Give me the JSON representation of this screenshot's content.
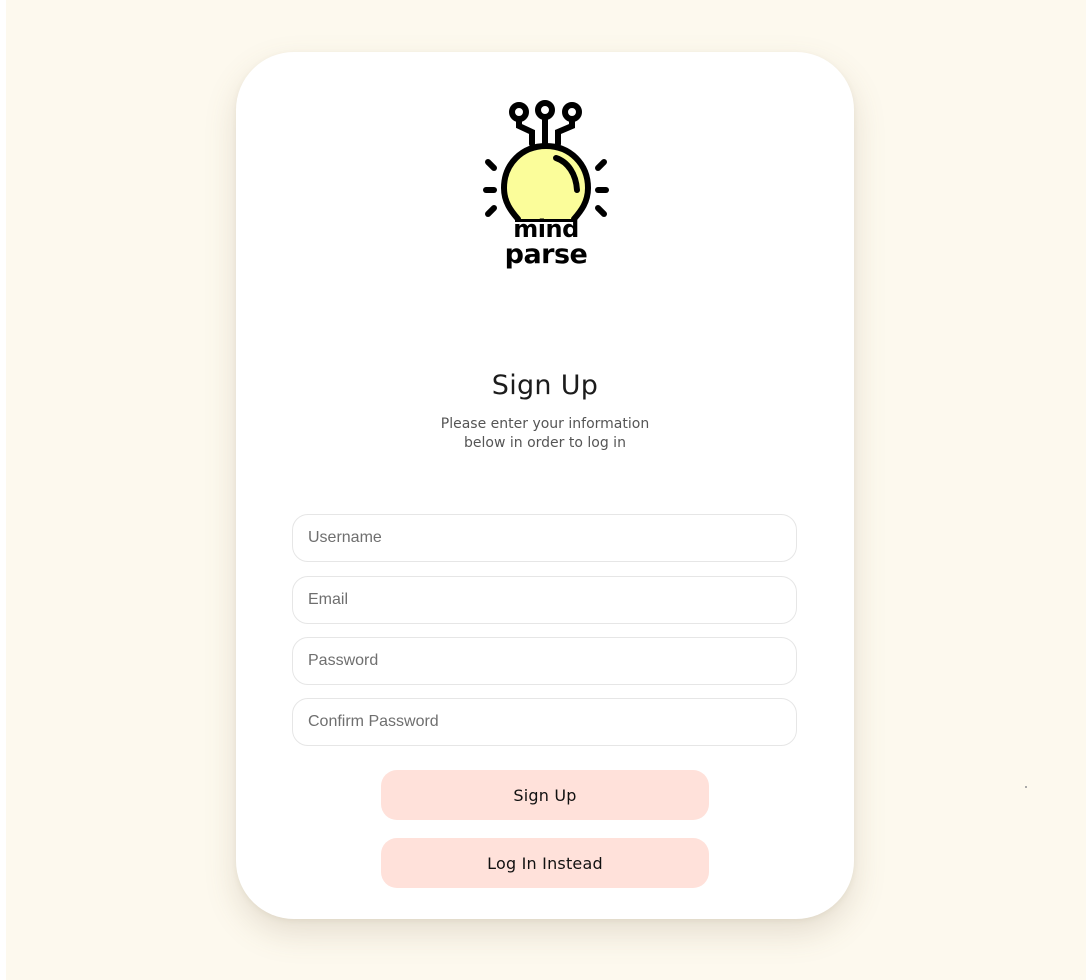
{
  "logo": {
    "line1": "mind",
    "line2": "parse",
    "icon": "lightbulb-icon",
    "bulb_color": "#fbfd9a"
  },
  "form": {
    "title": "Sign Up",
    "subtitle_line1": "Please enter your information",
    "subtitle_line2": "below in order to log in",
    "fields": {
      "username": {
        "placeholder": "Username",
        "value": ""
      },
      "email": {
        "placeholder": "Email",
        "value": ""
      },
      "password": {
        "placeholder": "Password",
        "value": ""
      },
      "confirm_password": {
        "placeholder": "Confirm Password",
        "value": ""
      }
    },
    "signup_button": "Sign Up",
    "login_button": "Log In Instead"
  },
  "colors": {
    "page_background": "#fdf9ee",
    "card_background": "#ffffff",
    "button_background": "#ffe1da"
  }
}
